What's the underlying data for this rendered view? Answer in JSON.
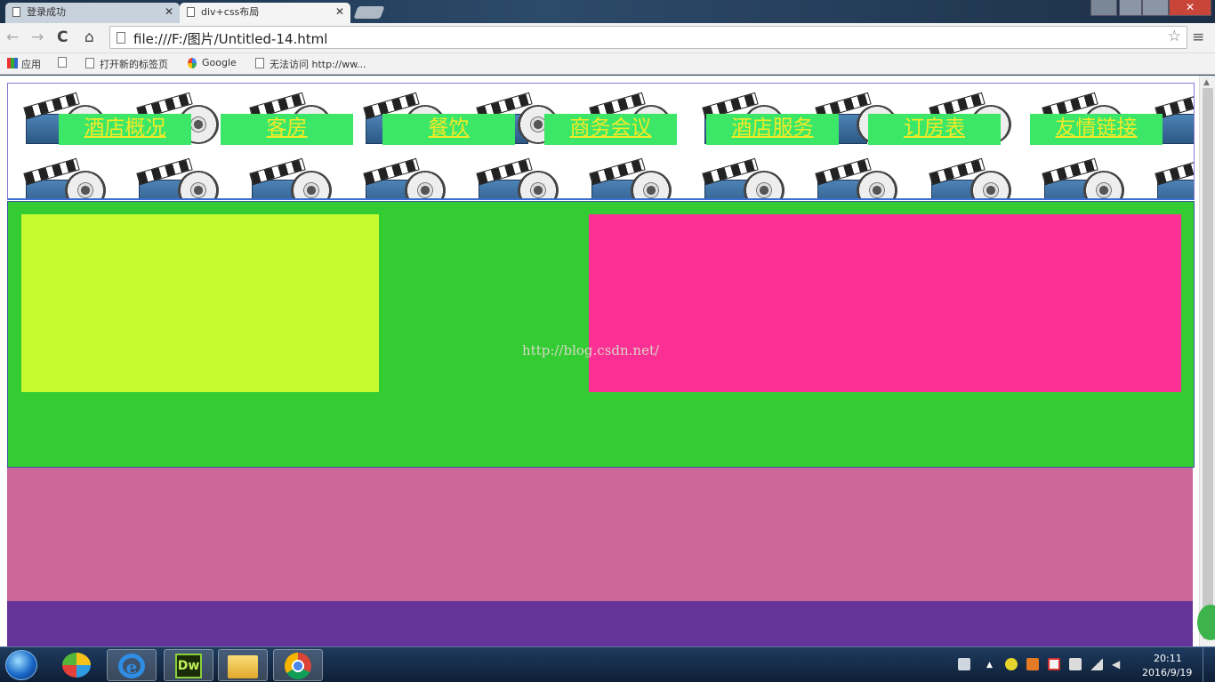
{
  "browser": {
    "tabs": [
      {
        "title": "登录成功",
        "active": false
      },
      {
        "title": "div+css布局",
        "active": true
      }
    ],
    "address": "file:///F:/图片/Untitled-14.html",
    "bookmarks": [
      {
        "label": "应用"
      },
      {
        "label": "打开新的标签页"
      },
      {
        "label": "Google"
      },
      {
        "label": "无法访问 http://ww..."
      }
    ]
  },
  "page": {
    "nav_items": [
      "酒店概况",
      "客房",
      "餐饮",
      "商务会议",
      "酒店服务",
      "订房表",
      "友情链接"
    ],
    "watermark": "http://blog.csdn.net/",
    "colors": {
      "nav_bg": "#3ce768",
      "nav_text": "#f2ea27",
      "main_bg": "#33cc33",
      "box_left": "#c8fa32",
      "box_right": "#fc2f94",
      "content_band": "#cc6699",
      "footer_band": "#663399"
    },
    "decoration_icon": "film-reel-icon"
  },
  "taskbar": {
    "apps": [
      "pinwheel-app-icon",
      "internet-explorer-icon",
      "dreamweaver-icon",
      "file-explorer-icon",
      "chrome-icon"
    ],
    "dw_label": "Dw",
    "time": "20:11",
    "date": "2016/9/19"
  }
}
